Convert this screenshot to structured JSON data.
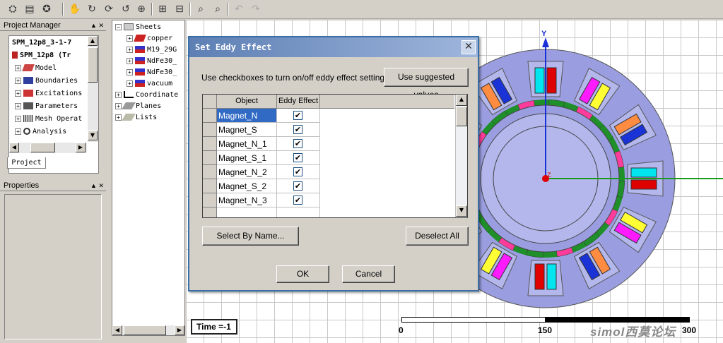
{
  "project_manager": {
    "title": "Project Manager",
    "pin": "▲ ✕",
    "root_label": "SPM_12p8_3-1-7",
    "design_label": "SPM_12p8 (Tr",
    "items": [
      {
        "label": "Model",
        "icon": "model-icon"
      },
      {
        "label": "Boundaries",
        "icon": "boundaries-icon"
      },
      {
        "label": "Excitations",
        "icon": "excitations-icon"
      },
      {
        "label": "Parameters",
        "icon": "parameters-icon"
      },
      {
        "label": "Mesh Operat",
        "icon": "mesh-icon"
      },
      {
        "label": "Analysis",
        "icon": "analysis-icon"
      }
    ],
    "tab": "Project"
  },
  "properties": {
    "title": "Properties",
    "pin": "▲ ✕"
  },
  "model_tree": {
    "sheets": "Sheets",
    "materials": [
      "copper",
      "M19_29G",
      "NdFe30_",
      "NdFe30_",
      "vacuum"
    ],
    "coordinate": "Coordinate",
    "planes": "Planes",
    "lists": "Lists"
  },
  "dialog": {
    "title": "Set Eddy Effect",
    "instruction": "Use checkboxes to turn on/off eddy effect settings:",
    "suggest_button": "Use suggested values",
    "col_object": "Object",
    "col_eddy": "Eddy Effect",
    "rows": [
      {
        "object": "Magnet_N",
        "checked": "✔",
        "selected": true
      },
      {
        "object": "Magnet_S",
        "checked": "✔",
        "selected": false
      },
      {
        "object": "Magnet_N_1",
        "checked": "✔",
        "selected": false
      },
      {
        "object": "Magnet_S_1",
        "checked": "✔",
        "selected": false
      },
      {
        "object": "Magnet_N_2",
        "checked": "✔",
        "selected": false
      },
      {
        "object": "Magnet_S_2",
        "checked": "✔",
        "selected": false
      },
      {
        "object": "Magnet_N_3",
        "checked": "✔",
        "selected": false
      }
    ],
    "select_by_name": "Select By Name...",
    "deselect_all": "Deselect All",
    "ok": "OK",
    "cancel": "Cancel"
  },
  "viewport": {
    "axis_y": "Y",
    "axis_z": "Z",
    "time_label": "Time =-1",
    "scale_start": "0",
    "scale_mid": "150",
    "scale_end": "300",
    "watermark": "simol西莫论坛"
  },
  "colors": {
    "stator": "#9a9ee0",
    "rotor": "#b3b7ec",
    "pink": "#ff3c9c",
    "green": "#1f8f2a"
  }
}
